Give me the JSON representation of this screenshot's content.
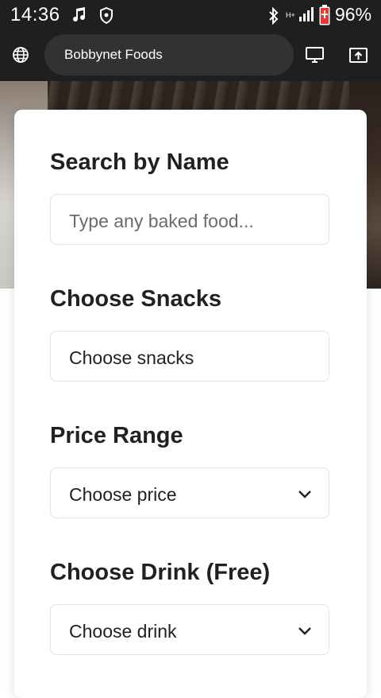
{
  "status_bar": {
    "time": "14:36",
    "battery_percent": "96%",
    "icons": [
      "music-note-icon",
      "shield-icon",
      "bluetooth-icon",
      "h-plus-icon",
      "signal-icon",
      "battery-icon"
    ]
  },
  "browser": {
    "site_title": "Bobbynet Foods",
    "icons": [
      "globe-icon",
      "desktop-icon",
      "share-screen-icon"
    ]
  },
  "form": {
    "search": {
      "title": "Search by Name",
      "placeholder": "Type any baked food..."
    },
    "snacks": {
      "title": "Choose Snacks",
      "value": "Choose snacks"
    },
    "price": {
      "title": "Price Range",
      "value": "Choose price"
    },
    "drink": {
      "title": "Choose Drink (Free)",
      "value": "Choose drink"
    }
  },
  "colors": {
    "status_bar_bg": "#1f1f1f",
    "url_pill_bg": "#323232",
    "card_bg": "#ffffff",
    "title_text": "#202124",
    "field_border": "#e3e3e3"
  }
}
